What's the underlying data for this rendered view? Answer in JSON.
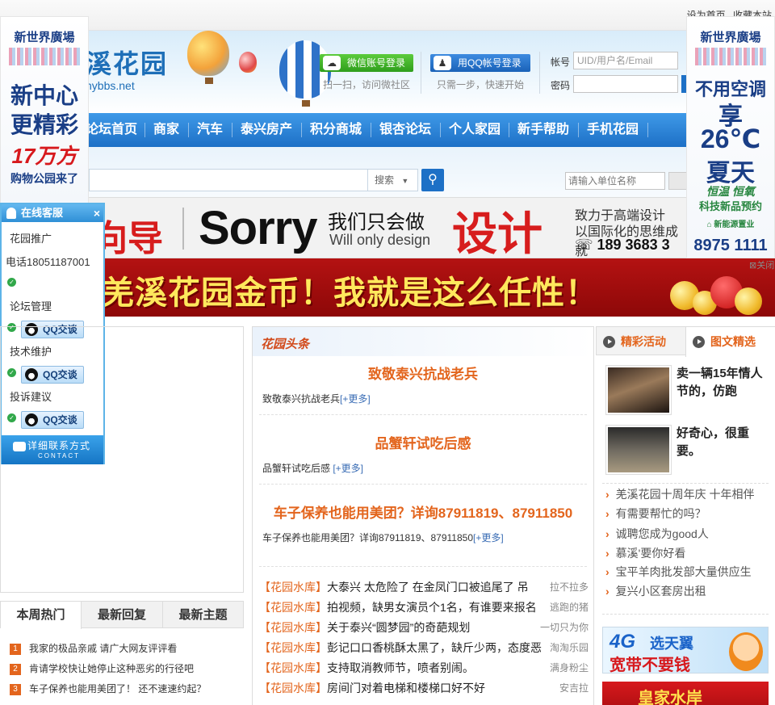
{
  "toplinks": {
    "homepage": "设为首页",
    "favorite": "收藏本站"
  },
  "header": {
    "logo_cn": "溪花园",
    "logo_en": "hybbs.net",
    "wechat_login": "微信账号登录",
    "wechat_icon": "wechat-icon",
    "wechat_sub": "扫一扫，访问微社区",
    "qq_login": "用QQ帐号登录",
    "qq_sub": "只需一步，快速开始",
    "account_label": "帐号",
    "account_placeholder": "UID/用户名/Email",
    "password_label": "密码"
  },
  "nav": {
    "items": [
      "论坛首页",
      "商家",
      "汽车",
      "泰兴房产",
      "积分商城",
      "银杏论坛",
      "个人家园",
      "新手帮助",
      "手机花园"
    ]
  },
  "search": {
    "type": "搜索",
    "unit_placeholder": "请输入单位名称",
    "button_icon": "search-icon"
  },
  "banner1": {
    "guide": "向导",
    "sorry": "Sorry",
    "only_cn": "我们只会做",
    "only_en": "Will only design",
    "design": "设计",
    "tag1": "致力于高端设计",
    "tag2": "以国际化的思维成就",
    "phone": "189 3683 3"
  },
  "banner2": {
    "text": "羌溪花园金币！我就是这么任性！"
  },
  "close_ad": "关闭",
  "left_ad": {
    "logo": "新世界廣場",
    "line1": "新中心",
    "line2": "更精彩",
    "price": "17万方",
    "line3": "购物公园来了"
  },
  "right_ad": {
    "logo": "新世界廣場",
    "line1": "不用空调",
    "line2": "享",
    "temp": "26℃",
    "line3": "夏天",
    "line4": "恒温 恒氧",
    "line5": "科技新品预约",
    "brand": "新能源置业",
    "phone": "8975 1111"
  },
  "customer_service": {
    "title": "在线客服",
    "close": "×",
    "promo": "花园推广",
    "phone": "电话18051187001",
    "group1": "论坛管理",
    "group2": "技术维护",
    "group3": "投诉建议",
    "qq_label": "QQ交谈",
    "footer_cn": "详细联系方式",
    "footer_en": "CONTACT"
  },
  "left_tabs": [
    "本周热门",
    "最新回复",
    "最新主题"
  ],
  "hot_list": [
    {
      "num": "1",
      "text": "我家的极品亲戚 请广大网友评评看",
      "color": "#e3651d"
    },
    {
      "num": "2",
      "text": "肯请学校快让她停止这种恶劣的行径吧",
      "color": "#e3651d"
    },
    {
      "num": "3",
      "text": "车子保养也能用美团了！ 还不速速约起？",
      "color": "#e3651d"
    }
  ],
  "middle": {
    "header": "花园头条",
    "headlines": [
      {
        "title": "致敬泰兴抗战老兵",
        "desc": "致敬泰兴抗战老兵",
        "more": "[+更多]"
      },
      {
        "title": "品蟹轩试吃后感",
        "desc": "品蟹轩试吃后感 ",
        "more": "[+更多]"
      },
      {
        "title": "车子保养也能用美团？详询87911819、87911850",
        "desc": "车子保养也能用美团？详询87911819、87911850",
        "more": "[+更多]"
      }
    ],
    "posts": [
      {
        "tag": "【花园水库】",
        "title": "大泰兴 太危险了 在金凤门口被追尾了 吊",
        "author": "拉不拉多"
      },
      {
        "tag": "【花园水库】",
        "title": "拍视频，缺男女演员个1名，有谁要来报名",
        "author": "逃跑的猪"
      },
      {
        "tag": "【花园水库】",
        "title": "关于泰兴“圆梦园”的奇葩规划",
        "author": "一切只为你"
      },
      {
        "tag": "【花园水库】",
        "title": "彭记口口香桃酥太黑了，缺斤少两，态度恶",
        "author": "淘淘乐园"
      },
      {
        "tag": "【花园水库】",
        "title": "支持取消教师节，喷者别闹。",
        "author": "满身粉尘"
      },
      {
        "tag": "【花园水库】",
        "title": "房间门对着电梯和楼梯口好不好",
        "author": "安吉拉"
      }
    ]
  },
  "right": {
    "tabs": [
      "精彩活动",
      "图文精选"
    ],
    "features": [
      {
        "caption": "卖一辆15年情人节的，仿跑"
      },
      {
        "caption": "好奇心，很重要。"
      }
    ],
    "list": [
      "羌溪花园十周年庆 十年相伴",
      "有需要帮忙的吗？",
      "诚聘您成为good人",
      "慕溪'要你好看",
      "宝平羊肉批发部大量供应生",
      "复兴小区套房出租"
    ],
    "ad4g_a": "4G",
    "ad4g_b": "选天翼",
    "ad4g_c": "宽带不要钱",
    "adred": "皇家水岸"
  }
}
